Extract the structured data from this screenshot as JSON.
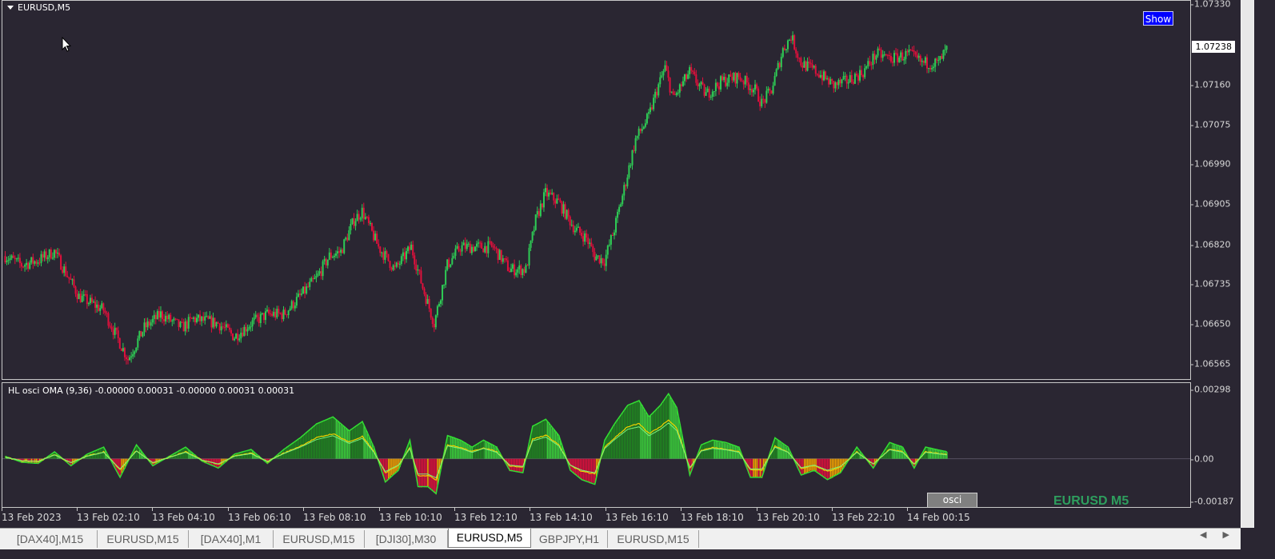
{
  "symbol_label": "EURUSD,M5",
  "show_button": "Show",
  "current_price": "1.07238",
  "price_axis": [
    "1.07330",
    "1.07160",
    "1.07075",
    "1.06990",
    "1.06905",
    "1.06820",
    "1.06735",
    "1.06650",
    "1.06565"
  ],
  "indicator_label": "HL osci OMA (9,36) -0.00000 0.00031 -0.00000 0.00031 0.00031",
  "indicator_axis": [
    "0.00298",
    "0.00",
    "-0.00187"
  ],
  "osci_button": "osci",
  "watermark": "EURUSD M5",
  "time_axis": [
    "13 Feb 2023",
    "13 Feb 02:10",
    "13 Feb 04:10",
    "13 Feb 06:10",
    "13 Feb 08:10",
    "13 Feb 10:10",
    "13 Feb 12:10",
    "13 Feb 14:10",
    "13 Feb 16:10",
    "13 Feb 18:10",
    "13 Feb 20:10",
    "13 Feb 22:10",
    "14 Feb 00:15"
  ],
  "tabs": [
    "[DAX40],M15",
    "EURUSD,M15",
    "[DAX40],M1",
    "EURUSD,M15",
    "[DJI30],M30",
    "EURUSD,M5",
    "GBPJPY,H1",
    "EURUSD,M15"
  ],
  "active_tab": "EURUSD,M5",
  "colors": {
    "background": "#2a2632",
    "bull": "#2ecc55",
    "bear": "#e0103c",
    "osc_up_dark": "#1f8a1f",
    "osc_up_light": "#3ad43a",
    "osc_down_red": "#e0103c",
    "osc_down_orange": "#f5a300",
    "signal_line": "#f0d000",
    "watermark": "#2e9e5e"
  },
  "chart_data": [
    {
      "type": "candlestick",
      "symbol": "EURUSD",
      "timeframe": "M5",
      "x_start": "13 Feb 2023 00:00",
      "bar_minutes": 5,
      "ylim": [
        1.0653,
        1.0735
      ],
      "close_path": [
        [
          0,
          1.0679
        ],
        [
          10,
          1.0677
        ],
        [
          20,
          1.0678
        ],
        [
          30,
          1.068
        ],
        [
          45,
          1.067
        ],
        [
          60,
          1.0667
        ],
        [
          75,
          1.0656
        ],
        [
          85,
          1.0663
        ],
        [
          95,
          1.0666
        ],
        [
          108,
          1.0663
        ],
        [
          115,
          1.0665
        ],
        [
          130,
          1.0664
        ],
        [
          140,
          1.0661
        ],
        [
          150,
          1.0664
        ],
        [
          160,
          1.0666
        ],
        [
          170,
          1.0666
        ],
        [
          180,
          1.067
        ],
        [
          190,
          1.0674
        ],
        [
          198,
          1.0679
        ],
        [
          205,
          1.068
        ],
        [
          213,
          1.0687
        ],
        [
          218,
          1.0689
        ],
        [
          228,
          1.0681
        ],
        [
          238,
          1.0676
        ],
        [
          248,
          1.0681
        ],
        [
          255,
          1.0672
        ],
        [
          262,
          1.0664
        ],
        [
          270,
          1.0677
        ],
        [
          278,
          1.0681
        ],
        [
          288,
          1.0681
        ],
        [
          298,
          1.0681
        ],
        [
          308,
          1.0676
        ],
        [
          318,
          1.0676
        ],
        [
          324,
          1.0687
        ],
        [
          330,
          1.0693
        ],
        [
          338,
          1.0691
        ],
        [
          348,
          1.0685
        ],
        [
          355,
          1.0683
        ],
        [
          360,
          1.0679
        ],
        [
          366,
          1.0678
        ],
        [
          372,
          1.0685
        ],
        [
          378,
          1.0694
        ],
        [
          385,
          1.0705
        ],
        [
          393,
          1.071
        ],
        [
          398,
          1.0716
        ],
        [
          403,
          1.0721
        ],
        [
          408,
          1.0714
        ],
        [
          418,
          1.072
        ],
        [
          428,
          1.0715
        ],
        [
          438,
          1.0718
        ],
        [
          448,
          1.0719
        ],
        [
          458,
          1.0716
        ],
        [
          462,
          1.0713
        ],
        [
          468,
          1.0716
        ],
        [
          475,
          1.0725
        ],
        [
          480,
          1.0728
        ],
        [
          486,
          1.0722
        ],
        [
          496,
          1.072
        ],
        [
          506,
          1.0717
        ],
        [
          514,
          1.0718
        ],
        [
          524,
          1.072
        ],
        [
          532,
          1.0724
        ],
        [
          542,
          1.0723
        ],
        [
          552,
          1.0724
        ],
        [
          560,
          1.0722
        ],
        [
          570,
          1.0722
        ],
        [
          575,
          1.0725
        ]
      ]
    },
    {
      "type": "histogram",
      "name": "HL osci OMA (9,36)",
      "ylim": [
        -0.00187,
        0.00298
      ],
      "values_path": [
        [
          0,
          0.0001
        ],
        [
          10,
          -0.00015
        ],
        [
          20,
          -0.0002
        ],
        [
          30,
          0.0003
        ],
        [
          40,
          -0.0003
        ],
        [
          50,
          0.0002
        ],
        [
          60,
          0.0005
        ],
        [
          70,
          -0.0008
        ],
        [
          80,
          0.0006
        ],
        [
          90,
          -0.0003
        ],
        [
          100,
          0.0001
        ],
        [
          110,
          0.0005
        ],
        [
          120,
          -0.0001
        ],
        [
          130,
          -0.0004
        ],
        [
          140,
          0.0002
        ],
        [
          150,
          0.0004
        ],
        [
          160,
          -0.0002
        ],
        [
          170,
          0.0004
        ],
        [
          180,
          0.0009
        ],
        [
          190,
          0.0015
        ],
        [
          200,
          0.0018
        ],
        [
          210,
          0.0012
        ],
        [
          218,
          0.0016
        ],
        [
          225,
          0.0005
        ],
        [
          232,
          -0.001
        ],
        [
          240,
          -0.0005
        ],
        [
          247,
          0.0008
        ],
        [
          252,
          -0.0012
        ],
        [
          258,
          -0.0012
        ],
        [
          263,
          -0.0015
        ],
        [
          270,
          0.001
        ],
        [
          278,
          0.0008
        ],
        [
          285,
          0.0005
        ],
        [
          292,
          0.0008
        ],
        [
          300,
          0.0005
        ],
        [
          308,
          -0.0005
        ],
        [
          316,
          -0.0006
        ],
        [
          322,
          0.0014
        ],
        [
          330,
          0.0017
        ],
        [
          338,
          0.001
        ],
        [
          345,
          -0.0005
        ],
        [
          352,
          -0.0009
        ],
        [
          360,
          -0.0011
        ],
        [
          366,
          0.0008
        ],
        [
          372,
          0.0015
        ],
        [
          380,
          0.0023
        ],
        [
          387,
          0.0025
        ],
        [
          393,
          0.0018
        ],
        [
          400,
          0.0023
        ],
        [
          405,
          0.0028
        ],
        [
          410,
          0.0022
        ],
        [
          418,
          -0.0007
        ],
        [
          425,
          0.0006
        ],
        [
          432,
          0.0008
        ],
        [
          440,
          0.0007
        ],
        [
          448,
          0.0005
        ],
        [
          455,
          -0.0008
        ],
        [
          462,
          -0.0008
        ],
        [
          470,
          0.0009
        ],
        [
          478,
          0.0005
        ],
        [
          486,
          -0.0007
        ],
        [
          494,
          -0.0005
        ],
        [
          502,
          -0.0009
        ],
        [
          510,
          -0.0006
        ],
        [
          520,
          0.0005
        ],
        [
          530,
          -0.0004
        ],
        [
          540,
          0.0007
        ],
        [
          548,
          0.0005
        ],
        [
          555,
          -0.0004
        ],
        [
          562,
          0.0005
        ],
        [
          575,
          0.0003
        ]
      ]
    }
  ]
}
